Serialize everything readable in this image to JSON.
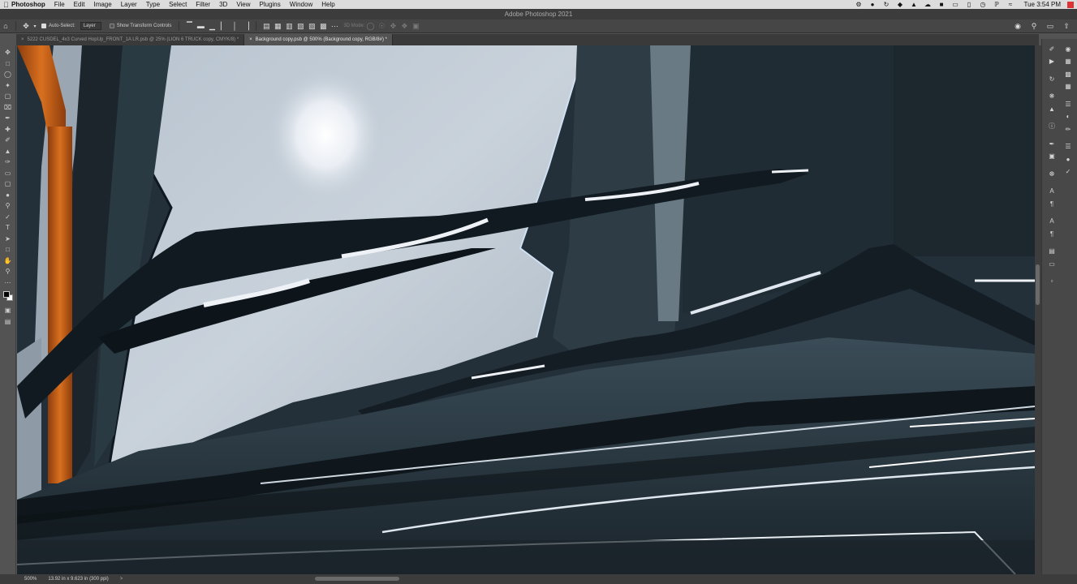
{
  "menubar": {
    "apple_icon": "apple-icon",
    "app_name": "Photoshop",
    "items": [
      "File",
      "Edit",
      "Image",
      "Layer",
      "Type",
      "Select",
      "Filter",
      "3D",
      "View",
      "Plugins",
      "Window",
      "Help"
    ],
    "clock": "Tue 3:54 PM"
  },
  "window": {
    "title": "Adobe Photoshop 2021"
  },
  "options": {
    "auto_select_label": "Auto-Select:",
    "auto_select_value": "Layer",
    "show_transform_label": "Show Transform Controls",
    "mode_3d_label": "3D Mode:"
  },
  "tabs": [
    {
      "label": "5222 CUSDEL_4x3 Curved HopUp_FRONT_1A LR.psb @ 25% (LION 6 TRUCK copy, CMYK/8) *",
      "active": false
    },
    {
      "label": "Background copy.psb @ 500% (Background copy, RGB/8#) *",
      "active": true
    }
  ],
  "status": {
    "zoom": "500%",
    "doc_info": "13.92 in x 9.623 in (300 ppi)",
    "arrow": ">"
  }
}
